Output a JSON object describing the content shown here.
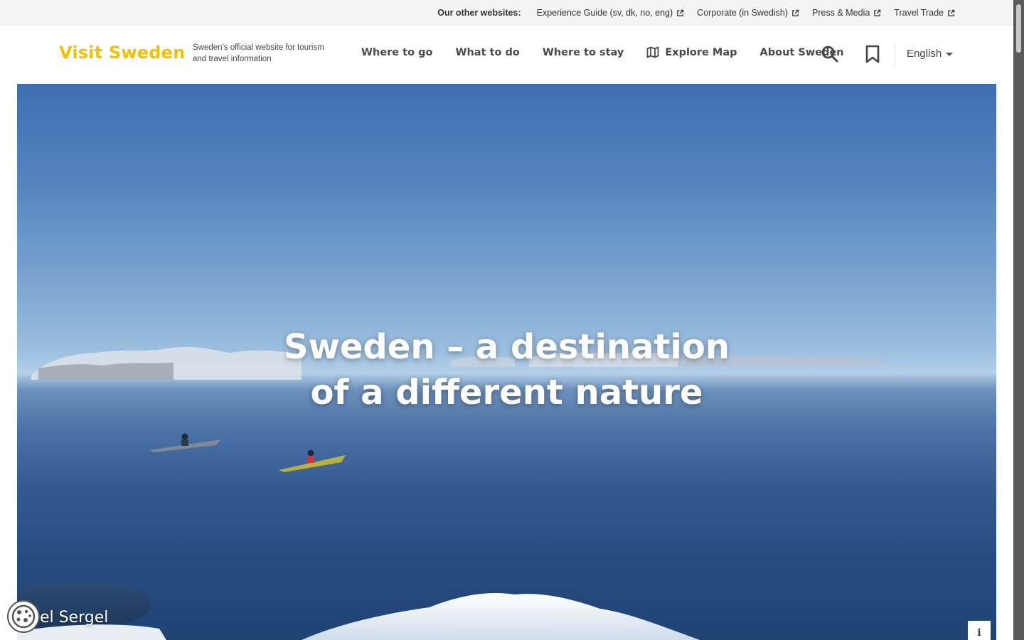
{
  "topbar": {
    "label": "Our other websites:",
    "links": [
      {
        "label": "Experience Guide (sv, dk, no, eng)"
      },
      {
        "label": "Corporate (in Swedish)"
      },
      {
        "label": "Press & Media"
      },
      {
        "label": "Travel Trade"
      }
    ]
  },
  "header": {
    "logo": "Visit Sweden",
    "tagline": "Sweden's official website for tourism and travel information",
    "nav": [
      {
        "label": "Where to go"
      },
      {
        "label": "What to do"
      },
      {
        "label": "Where to stay"
      },
      {
        "label": "Explore Map",
        "icon": "map-icon"
      },
      {
        "label": "About Sweden"
      }
    ],
    "search_icon": "search-icon",
    "bookmark_icon": "bookmark-icon",
    "language": "English"
  },
  "hero": {
    "title_line1": "Sweden – a destination",
    "title_line2": "of a different nature",
    "credit": "hel Sergel",
    "info_label": "i"
  },
  "colors": {
    "brand_yellow": "#f2c200",
    "topbar_bg": "#f4f4f4",
    "nav_text": "#4a4a4a"
  }
}
